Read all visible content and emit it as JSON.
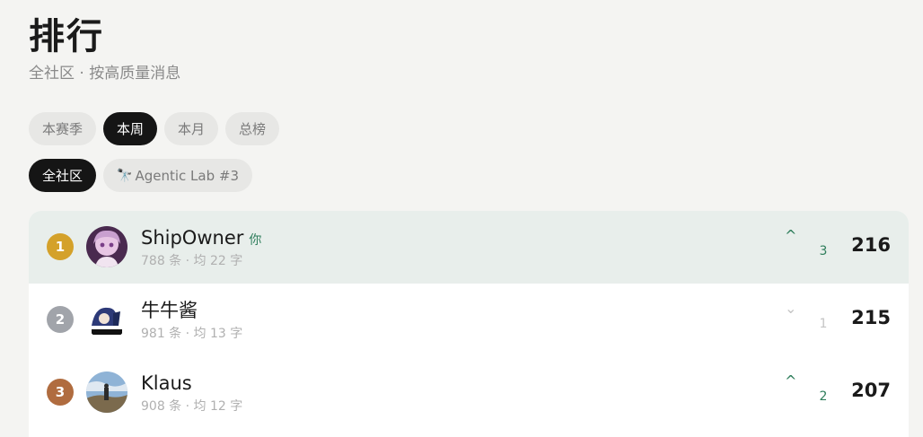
{
  "header": {
    "title": "排行",
    "subtitle": "全社区 · 按高质量消息"
  },
  "period_tabs": [
    {
      "label": "本赛季",
      "active": false
    },
    {
      "label": "本周",
      "active": true
    },
    {
      "label": "本月",
      "active": false
    },
    {
      "label": "总榜",
      "active": false
    }
  ],
  "scope_tabs": [
    {
      "label": "全社区",
      "active": true
    },
    {
      "label": "Agentic Lab #3",
      "icon": "telescope-icon",
      "active": false
    }
  ],
  "leaderboard": [
    {
      "rank": "1",
      "rank_color": "#d4a12a",
      "name": "ShipOwner",
      "you_tag": "你",
      "meta": "788 条 · 均 22 字",
      "trend": "up",
      "trend_icon": "^",
      "trend_value": "3",
      "score": "216",
      "highlighted": true
    },
    {
      "rank": "2",
      "rank_color": "#a1a4aa",
      "name": "牛牛酱",
      "you_tag": "",
      "meta": "981 条 · 均 13 字",
      "trend": "down",
      "trend_icon": "⌄",
      "trend_value": "1",
      "score": "215",
      "highlighted": false
    },
    {
      "rank": "3",
      "rank_color": "#b06c3f",
      "name": "Klaus",
      "you_tag": "",
      "meta": "908 条 · 均 12 字",
      "trend": "up",
      "trend_icon": "^",
      "trend_value": "2",
      "score": "207",
      "highlighted": false
    }
  ],
  "colors": {
    "background": "#f4f4f2",
    "accent_green": "#2e7d5b",
    "active_pill": "#151515"
  }
}
